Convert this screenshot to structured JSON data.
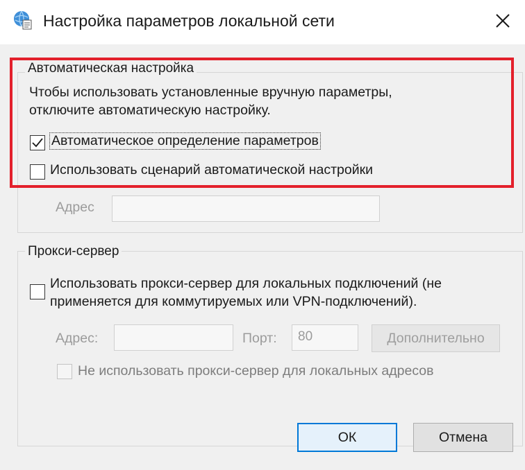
{
  "window": {
    "title": "Настройка параметров локальной сети",
    "icon": "network-settings-icon",
    "close_icon": "close-icon"
  },
  "auto_config": {
    "group_label": "Автоматическая настройка",
    "description_line1": "Чтобы использовать установленные вручную параметры,",
    "description_line2": "отключите автоматическую настройку.",
    "auto_detect": {
      "label": "Автоматическое определение параметров",
      "checked": true
    },
    "use_script": {
      "label": "Использовать сценарий автоматической настройки",
      "checked": false
    },
    "address_label": "Адрес",
    "address_value": ""
  },
  "proxy": {
    "group_label": "Прокси-сервер",
    "use_proxy": {
      "label_line1": "Использовать прокси-сервер для локальных подключений (не",
      "label_line2": "применяется для коммутируемых или VPN-подключений).",
      "checked": false
    },
    "address_label": "Адрес:",
    "address_value": "",
    "port_label": "Порт:",
    "port_value": "80",
    "advanced_button": "Дополнительно",
    "bypass_local": {
      "label": "Не использовать прокси-сервер для локальных адресов",
      "checked": false
    }
  },
  "buttons": {
    "ok": "ОК",
    "cancel": "Отмена"
  },
  "colors": {
    "highlight": "#e3202b",
    "default_button_border": "#0078d7",
    "dialog_background": "#f0f0f0"
  }
}
